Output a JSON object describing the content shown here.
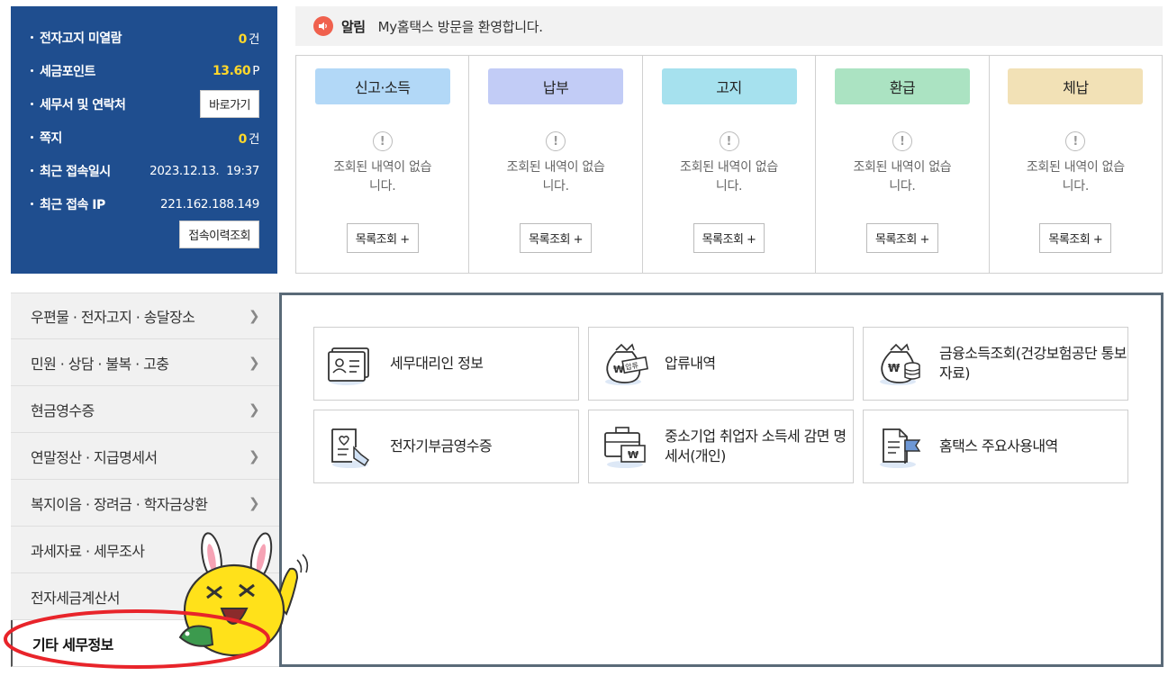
{
  "info_panel": {
    "rows": [
      {
        "label": "전자고지 미열람",
        "value": "0",
        "unit": "건"
      },
      {
        "label": "세금포인트",
        "value": "13.60",
        "unit": "P"
      },
      {
        "label": "세무서 및 연락처",
        "button": "바로가기"
      },
      {
        "label": "쪽지",
        "value": "0",
        "unit": "건"
      },
      {
        "label": "최근 접속일시",
        "text": "2023.12.13.  19:37"
      },
      {
        "label": "최근 접속 IP",
        "text": "221.162.188.149"
      }
    ],
    "history_button": "접속이력조회",
    "value_color": "#ffd82a",
    "bg_color": "#1f4e8f"
  },
  "notice": {
    "label": "알림",
    "text": "My홈택스 방문을 환영합니다.",
    "icon": "speaker-icon"
  },
  "status_columns": [
    {
      "title": "신고·소득",
      "color": "#b2d8f7",
      "empty_text": "조회된 내역이 없습니다.",
      "button": "목록조회 +"
    },
    {
      "title": "납부",
      "color": "#c2ccf6",
      "empty_text": "조회된 내역이 없습니다.",
      "button": "목록조회 +"
    },
    {
      "title": "고지",
      "color": "#a6e1ee",
      "empty_text": "조회된 내역이 없습니다.",
      "button": "목록조회 +"
    },
    {
      "title": "환급",
      "color": "#abe3c2",
      "empty_text": "조회된 내역이 없습니다.",
      "button": "목록조회 +"
    },
    {
      "title": "체납",
      "color": "#f2e1b6",
      "empty_text": "조회된 내역이 없습니다.",
      "button": "목록조회 +"
    }
  ],
  "left_menu": [
    {
      "label": "우편물 · 전자고지 · 송달장소",
      "chevron": true
    },
    {
      "label": "민원 · 상담 · 불복 · 고충",
      "chevron": true
    },
    {
      "label": "현금영수증",
      "chevron": true
    },
    {
      "label": "연말정산 · 지급명세서",
      "chevron": true
    },
    {
      "label": "복지이음 · 장려금 · 학자금상환",
      "chevron": true
    },
    {
      "label": "과세자료 · 세무조사",
      "chevron": false
    },
    {
      "label": "전자세금계산서",
      "chevron": false
    },
    {
      "label": "기타 세무정보",
      "chevron": false,
      "active": true
    }
  ],
  "cards": [
    {
      "label": "세무대리인 정보",
      "icon": "agent-card-icon"
    },
    {
      "label": "압류내역",
      "icon": "seizure-bag-icon"
    },
    {
      "label": "금융소득조회(건강보험공단 통보자료)",
      "icon": "money-bag-coins-icon"
    },
    {
      "label": "전자기부금영수증",
      "icon": "donation-receipt-icon"
    },
    {
      "label": "중소기업 취업자 소득세 감면 명세서(개인)",
      "icon": "briefcase-won-icon"
    },
    {
      "label": "홈택스 주요사용내역",
      "icon": "document-flag-icon"
    }
  ],
  "annotation": {
    "color": "#e8242a",
    "icon": "mascot-rabbit-icon"
  }
}
